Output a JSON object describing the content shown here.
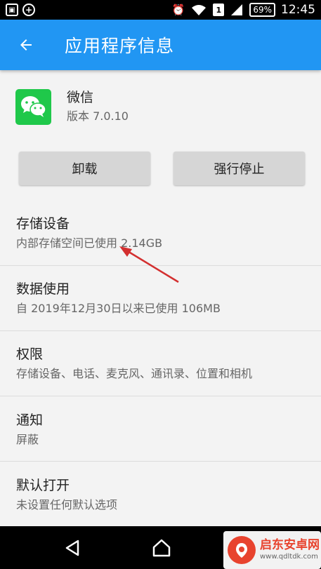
{
  "status_bar": {
    "battery": "69%",
    "time": "12:45",
    "sim": "1"
  },
  "app_bar": {
    "title": "应用程序信息"
  },
  "app": {
    "name": "微信",
    "version": "版本 7.0.10"
  },
  "buttons": {
    "uninstall": "卸载",
    "force_stop": "强行停止"
  },
  "rows": [
    {
      "title": "存储设备",
      "subtitle": "内部存储空间已使用 2.14GB"
    },
    {
      "title": "数据使用",
      "subtitle": "自 2019年12月30日以来已使用 106MB"
    },
    {
      "title": "权限",
      "subtitle": "存储设备、电话、麦克风、通讯录、位置和相机"
    },
    {
      "title": "通知",
      "subtitle": "屏蔽"
    },
    {
      "title": "默认打开",
      "subtitle": "未设置任何默认选项"
    }
  ],
  "watermark": {
    "name": "启东安卓网",
    "url": "www.qdltdk.com"
  },
  "colors": {
    "app_bar": "#2196f3",
    "wechat_green": "#1fc84a",
    "annotation_arrow": "#d32f2f"
  },
  "icons": [
    "back-arrow-icon",
    "wechat-icon",
    "wifi-icon",
    "signal-icon",
    "alarm-icon",
    "nav-back-icon",
    "nav-home-icon"
  ]
}
